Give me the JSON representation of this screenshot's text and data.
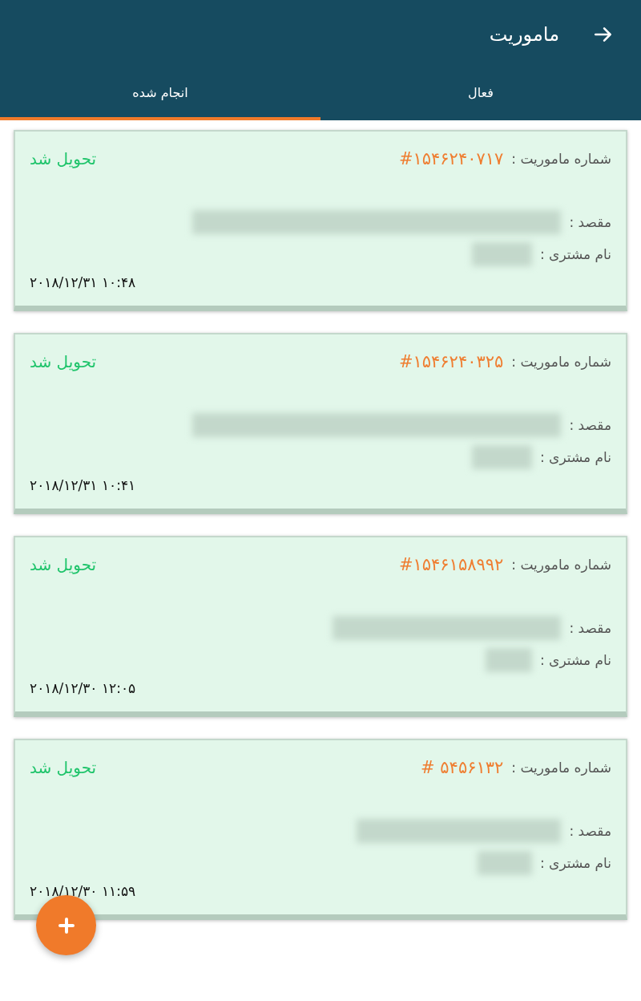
{
  "app_bar": {
    "title": "ماموریت"
  },
  "tabs": [
    {
      "label": "فعال",
      "selected": false
    },
    {
      "label": "انجام شده",
      "selected": true
    }
  ],
  "missions": [
    {
      "mission_label": "شماره ماموریت :",
      "mission_number": "#۱۵۴۶۲۴۰۷۱۷",
      "status": "تحویل شد",
      "destination_label": "مقصد :",
      "customer_label": "نام مشتری :",
      "datetime": "۲۰۱۸/۱۲/۳۱ ۱۰:۴۸"
    },
    {
      "mission_label": "شماره ماموریت :",
      "mission_number": "#۱۵۴۶۲۴۰۳۲۵",
      "status": "تحویل شد",
      "destination_label": "مقصد :",
      "customer_label": "نام مشتری :",
      "datetime": "۲۰۱۸/۱۲/۳۱ ۱۰:۴۱"
    },
    {
      "mission_label": "شماره ماموریت :",
      "mission_number": "#۱۵۴۶۱۵۸۹۹۲",
      "status": "تحویل شد",
      "destination_label": "مقصد :",
      "customer_label": "نام مشتری :",
      "datetime": "۲۰۱۸/۱۲/۳۰ ۱۲:۰۵"
    },
    {
      "mission_label": "شماره ماموریت :",
      "mission_number": "# ۵۴۵۶۱۳۲",
      "status": "تحویل شد",
      "destination_label": "مقصد :",
      "customer_label": "نام مشتری :",
      "datetime": "۲۰۱۸/۱۲/۳۰ ۱۱:۵۹"
    }
  ]
}
